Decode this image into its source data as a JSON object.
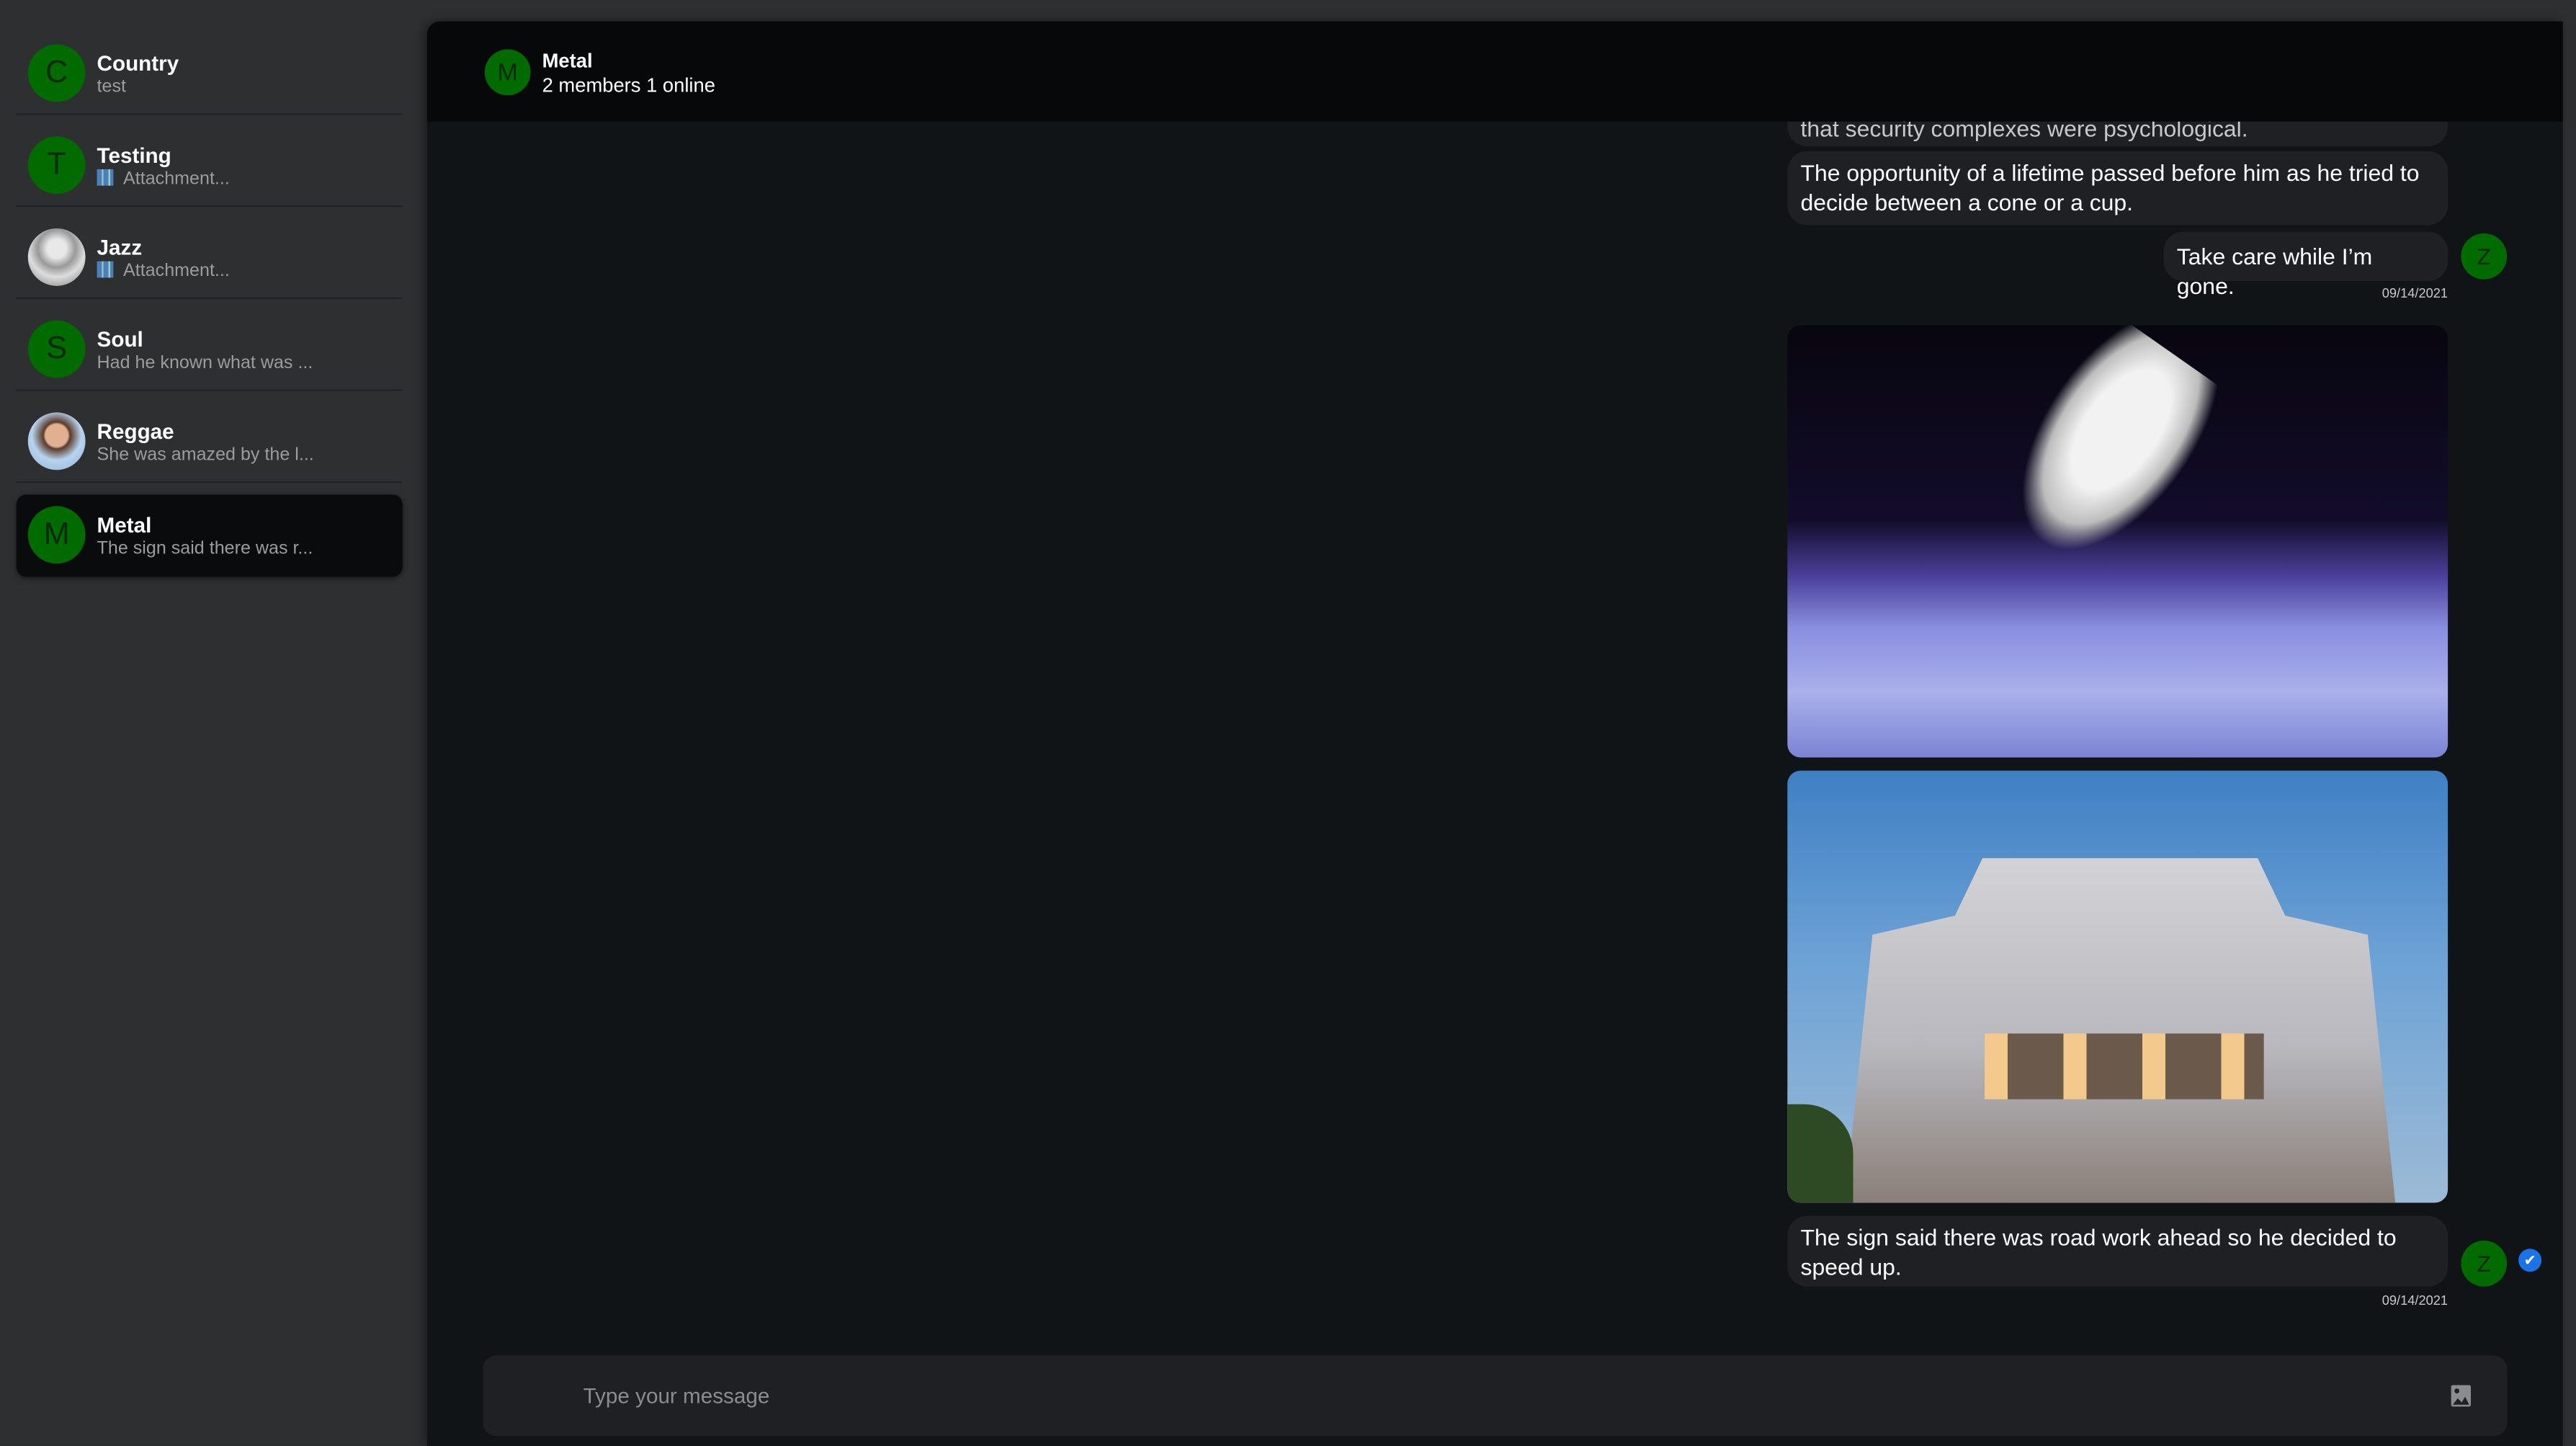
{
  "sidebar": {
    "items": [
      {
        "initial": "C",
        "name": "Country",
        "preview": "test",
        "avatar": "letter"
      },
      {
        "initial": "T",
        "name": "Testing",
        "preview": "Attachment...",
        "avatar": "letter",
        "attachment": true
      },
      {
        "initial": "",
        "name": "Jazz",
        "preview": "Attachment...",
        "avatar": "photo",
        "attachment": true
      },
      {
        "initial": "S",
        "name": "Soul",
        "preview": "Had he known what was ...",
        "avatar": "letter"
      },
      {
        "initial": "",
        "name": "Reggae",
        "preview": "She was amazed by the l...",
        "avatar": "photo"
      },
      {
        "initial": "M",
        "name": "Metal",
        "preview": "The sign said there was r...",
        "avatar": "letter",
        "selected": true
      }
    ]
  },
  "header": {
    "initial": "M",
    "title": "Metal",
    "subtitle": "2 members 1 online"
  },
  "messages": [
    {
      "text": "that security complexes were psychological."
    },
    {
      "text": "The opportunity of a lifetime passed before him as he tried to decide between a cone or a cup."
    },
    {
      "text": "Take care while I’m gone.",
      "avatar": "Z",
      "date": "09/14/2021"
    },
    {
      "image": "astronaut above Earth"
    },
    {
      "image": "ornate neoclassical building at dusk"
    },
    {
      "text": "The sign said there was road work ahead so he decided to speed up.",
      "avatar": "Z",
      "date": "09/14/2021",
      "status": "read"
    }
  ],
  "composer": {
    "placeholder": "Type your message",
    "attach_icon": "image-icon"
  },
  "colors": {
    "avatar": "#016b00",
    "read_check": "#1a73e8",
    "bubble": "#1e2024"
  }
}
